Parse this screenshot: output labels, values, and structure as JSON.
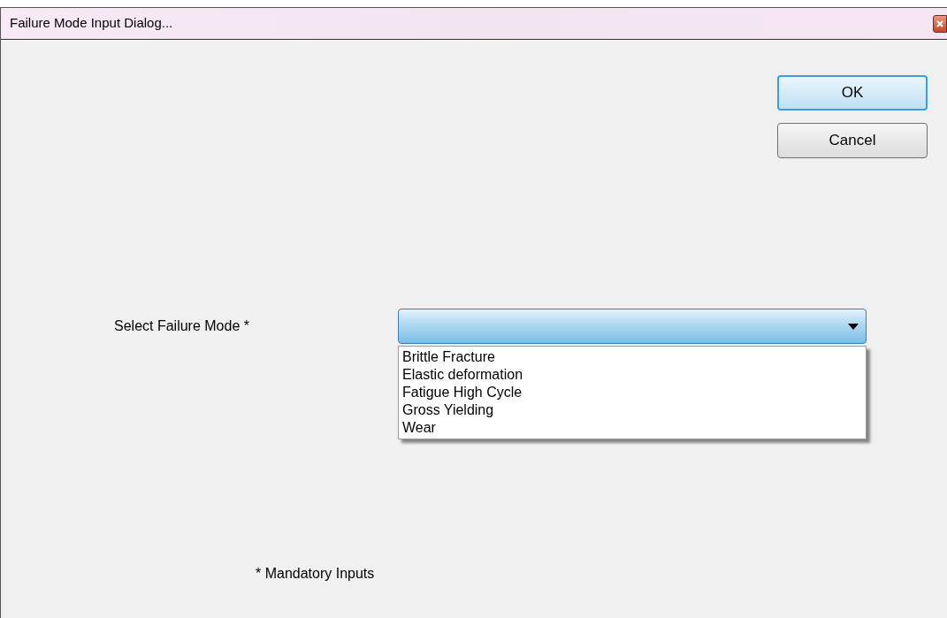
{
  "window": {
    "title": "Failure Mode Input Dialog..."
  },
  "buttons": [
    {
      "label": "OK",
      "default": true
    },
    {
      "label": "Cancel",
      "default": false
    }
  ],
  "failure_mode": {
    "label": "Select Failure Mode *",
    "expanded": true,
    "options": [
      {
        "label": "Brittle Fracture",
        "selected": false
      },
      {
        "label": "Elastic deformation",
        "selected": false
      },
      {
        "label": "Fatigue High Cycle",
        "selected": false
      },
      {
        "label": "Gross Yielding",
        "selected": false
      },
      {
        "label": "Wear",
        "selected": false
      }
    ]
  },
  "footnote": "* Mandatory Inputs"
}
